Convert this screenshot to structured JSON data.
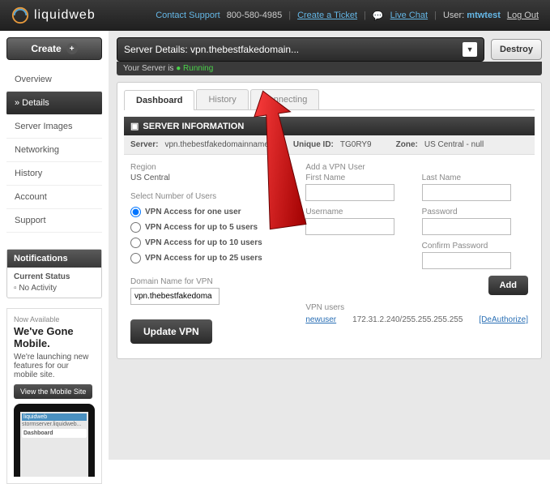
{
  "brand": "liquidweb",
  "header": {
    "contact": "Contact Support",
    "phone": "800-580-4985",
    "ticket": "Create a Ticket",
    "chat": "Live Chat",
    "user_label": "User:",
    "username": "mtwtest",
    "logout": "Log Out"
  },
  "sidebar": {
    "create": "Create",
    "items": [
      "Overview",
      "» Details",
      "Server Images",
      "Networking",
      "History",
      "Account",
      "Support"
    ],
    "active_index": 1,
    "notifications": {
      "title": "Notifications",
      "status_label": "Current Status",
      "activity": "No Activity"
    },
    "mobile": {
      "pre": "Now Available",
      "title": "We've Gone Mobile.",
      "desc": "We're launching new features for our mobile site.",
      "button": "View the Mobile Site",
      "phone_dash": "Dashboard"
    }
  },
  "content": {
    "server_title": "Server Details: vpn.thebestfakedomain...",
    "destroy": "Destroy",
    "status_pre": "Your Server is",
    "status_val": "Running",
    "tabs": [
      "Dashboard",
      "History",
      "Connecting"
    ],
    "active_tab": 0,
    "section": "SERVER INFORMATION",
    "info": {
      "server_label": "Server:",
      "server_val": "vpn.thebestfakedomainname",
      "uid_label": "Unique ID:",
      "uid_val": "TG0RY9",
      "zone_label": "Zone:",
      "zone_val": "US Central - null"
    },
    "form": {
      "region_label": "Region",
      "region_val": "US Central",
      "users_label": "Select Number of Users",
      "user_options": [
        "VPN Access for one user",
        "VPN Access for up to 5 users",
        "VPN Access for up to 10 users",
        "VPN Access for up to 25 users"
      ],
      "selected_option": 0,
      "domain_label": "Domain Name for VPN",
      "domain_val": "vpn.thebestfakedoma",
      "update": "Update VPN",
      "add_user_title": "Add a VPN User",
      "first_name": "First Name",
      "last_name": "Last Name",
      "username": "Username",
      "password": "Password",
      "confirm_password": "Confirm Password",
      "add": "Add",
      "vpn_users_label": "VPN users",
      "vpn_user": {
        "name": "newuser",
        "ip": "172.31.2.240/255.255.255.255",
        "action": "[DeAuthorize]"
      }
    }
  }
}
